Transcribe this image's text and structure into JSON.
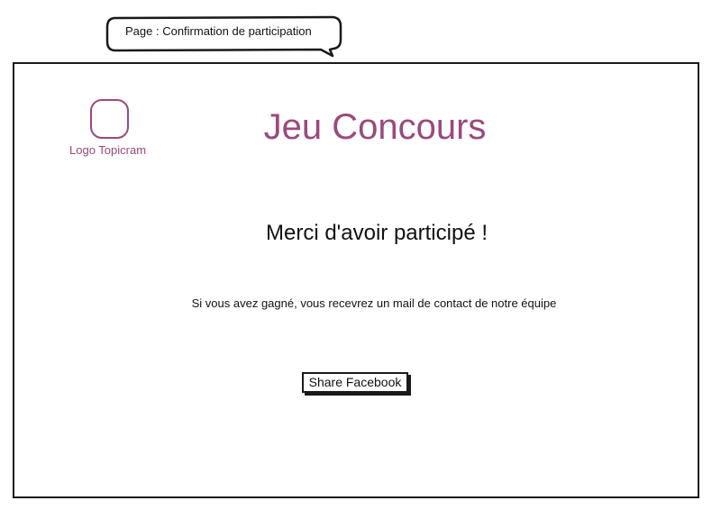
{
  "annotation": {
    "page_label": "Page : Confirmation de participation"
  },
  "header": {
    "logo_label": "Logo Topicram",
    "title": "Jeu Concours"
  },
  "main": {
    "heading": "Merci d'avoir participé !",
    "info_text": "Si vous avez gagné, vous recevrez un mail de contact de notre équipe",
    "share_button_label": "Share Facebook"
  },
  "colors": {
    "accent": "#9a4a7e",
    "ink": "#111111"
  }
}
